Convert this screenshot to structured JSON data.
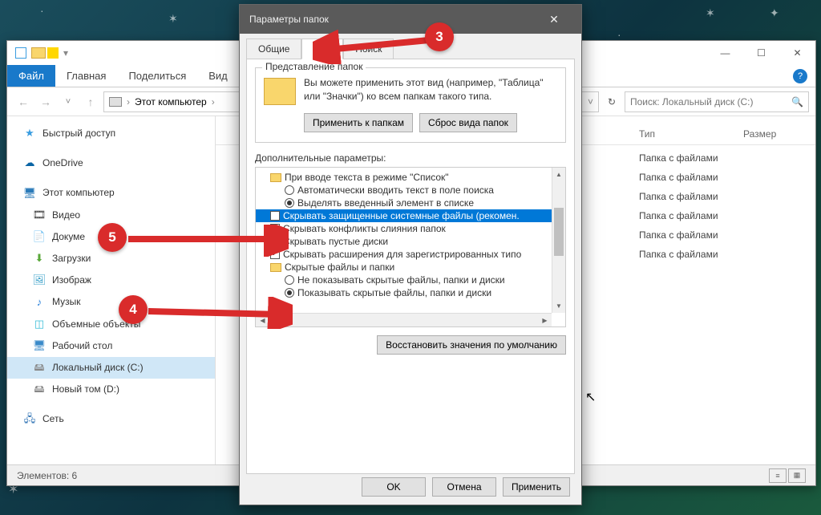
{
  "explorer": {
    "ribbon": {
      "file": "Файл",
      "home": "Главная",
      "share": "Поделиться",
      "view": "Вид"
    },
    "path": {
      "root": "Этот компьютер",
      "sep": "›"
    },
    "search_placeholder": "Поиск: Локальный диск (C:)",
    "columns": {
      "type": "Тип",
      "size": "Размер"
    },
    "nav": {
      "quick": "Быстрый доступ",
      "onedrive": "OneDrive",
      "thispc": "Этот компьютер",
      "video": "Видео",
      "docs": "Докуме",
      "downloads": "Загрузки",
      "images": "Изображ",
      "music": "Музык",
      "objects": "Объемные объекты",
      "desktop": "Рабочий стол",
      "cdrive": "Локальный диск (C:)",
      "ddrive": "Новый том (D:)",
      "network": "Сеть"
    },
    "type_folder": "Папка с файлами",
    "status": "Элементов: 6"
  },
  "dialog": {
    "title": "Параметры папок",
    "tabs": {
      "general": "Общие",
      "view": "Вид",
      "search": "Поиск"
    },
    "fieldset_legend": "Представление папок",
    "folder_text": "Вы можете применить этот вид (например, \"Таблица\" или \"Значки\") ко всем папкам такого типа.",
    "btn_apply_folders": "Применить к папкам",
    "btn_reset_folders": "Сброс вида папок",
    "adv_label": "Дополнительные параметры:",
    "tree": {
      "i0": "При вводе текста в режиме \"Список\"",
      "i1": "Автоматически вводить текст в поле поиска",
      "i2": "Выделять введенный элемент в списке",
      "i3": "Скрывать защищенные системные файлы (рекомен.",
      "i4": "Скрывать конфликты слияния папок",
      "i5": "Скрывать пустые диски",
      "i6": "Скрывать расширения для зарегистрированных типо",
      "i7": "Скрытые файлы и папки",
      "i8": "Не показывать скрытые файлы, папки и диски",
      "i9": "Показывать скрытые файлы, папки и диски"
    },
    "btn_restore": "Восстановить значения по умолчанию",
    "btn_ok": "OK",
    "btn_cancel": "Отмена",
    "btn_apply": "Применить"
  },
  "callouts": {
    "c3": "3",
    "c4": "4",
    "c5": "5"
  }
}
